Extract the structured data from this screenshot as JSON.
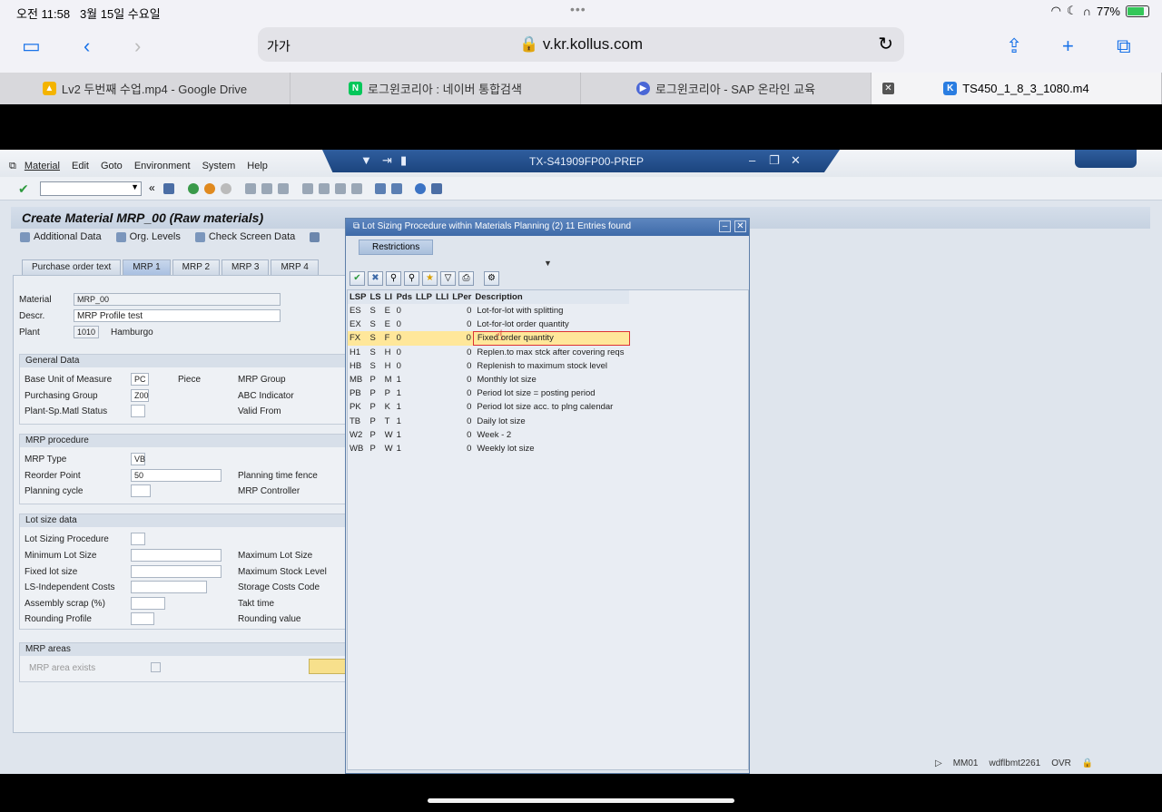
{
  "ipad": {
    "time": "오전 11:58",
    "date": "3월 15일 수요일",
    "battery": "77%",
    "battery_level": 0.77
  },
  "safari": {
    "text_size": "가가",
    "url": "v.kr.kollus.com"
  },
  "browser_tabs": [
    {
      "label": "Lv2 두번째 수업.mp4 - Google Drive",
      "icon": "google-drive-icon"
    },
    {
      "label": "로그윈코리아 : 네이버 통합검색",
      "icon": "naver-icon"
    },
    {
      "label": "로그윈코리아 - SAP 온라인 교육",
      "icon": "play-icon"
    },
    {
      "label": "TS450_1_8_3_1080.m4",
      "icon": "kollus-icon"
    }
  ],
  "sap": {
    "menu": [
      "Material",
      "Edit",
      "Goto",
      "Environment",
      "System",
      "Help"
    ],
    "system": "TX-S41909FP00-PREP",
    "screen_title": "Create Material MRP_00 (Raw materials)",
    "app_toolbar": [
      "Additional Data",
      "Org. Levels",
      "Check Screen Data"
    ],
    "tabs": [
      "Purchase order text",
      "MRP 1",
      "MRP 2",
      "MRP 3",
      "MRP 4"
    ],
    "header": {
      "material_label": "Material",
      "material": "MRP_00",
      "descr_label": "Descr.",
      "descr": "MRP Profile test",
      "plant_label": "Plant",
      "plant": "1010",
      "plant_name": "Hamburgo"
    },
    "general": {
      "title": "General Data",
      "buom_label": "Base Unit of Measure",
      "buom": "PC",
      "buom_text": "Piece",
      "mrp_group": "MRP Group",
      "pgrp_label": "Purchasing Group",
      "pgrp": "Z00",
      "abc": "ABC Indicator",
      "status_label": "Plant-Sp.Matl Status",
      "valid_from": "Valid From"
    },
    "mrp_proc": {
      "title": "MRP procedure",
      "type_label": "MRP Type",
      "type": "VB",
      "reorder_label": "Reorder Point",
      "reorder": "50",
      "fence": "Planning time fence",
      "cycle_label": "Planning cycle",
      "controller": "MRP Controller"
    },
    "lot": {
      "title": "Lot size data",
      "lsp": "Lot Sizing Procedure",
      "min": "Minimum Lot Size",
      "max": "Maximum Lot Size",
      "fixed": "Fixed lot size",
      "maxstock": "Maximum Stock Level",
      "lsind": "LS-Independent Costs",
      "storage": "Storage Costs Code",
      "scrap": "Assembly scrap (%)",
      "takt": "Takt time",
      "rprof": "Rounding Profile",
      "rval": "Rounding value"
    },
    "areas": {
      "title": "MRP areas",
      "exists": "MRP area exists"
    },
    "status": {
      "tcode": "MM01",
      "server": "wdflbmt2261",
      "mode": "OVR"
    }
  },
  "dialog": {
    "title": "Lot Sizing Procedure within Materials Planning (2)   11 Entries found",
    "restrictions": "Restrictions",
    "columns": [
      "LSP",
      "LS",
      "LI",
      "Pds",
      "LLP",
      "LLI",
      "LPer",
      "Description"
    ],
    "rows": [
      [
        "ES",
        "S",
        "E",
        "0",
        "",
        "",
        "0",
        "Lot-for-lot with splitting"
      ],
      [
        "EX",
        "S",
        "E",
        "0",
        "",
        "",
        "0",
        "Lot-for-lot order quantity"
      ],
      [
        "FX",
        "S",
        "F",
        "0",
        "",
        "",
        "0",
        "Fixed order quantity"
      ],
      [
        "H1",
        "S",
        "H",
        "0",
        "",
        "",
        "0",
        "Replen.to max stck after covering reqs"
      ],
      [
        "HB",
        "S",
        "H",
        "0",
        "",
        "",
        "0",
        "Replenish to maximum stock level"
      ],
      [
        "MB",
        "P",
        "M",
        "1",
        "",
        "",
        "0",
        "Monthly lot size"
      ],
      [
        "PB",
        "P",
        "P",
        "1",
        "",
        "",
        "0",
        "Period lot size = posting period"
      ],
      [
        "PK",
        "P",
        "K",
        "1",
        "",
        "",
        "0",
        "Period lot size acc. to plng calendar"
      ],
      [
        "TB",
        "P",
        "T",
        "1",
        "",
        "",
        "0",
        "Daily lot size"
      ],
      [
        "W2",
        "P",
        "W",
        "1",
        "",
        "",
        "0",
        "Week - 2"
      ],
      [
        "WB",
        "P",
        "W",
        "1",
        "",
        "",
        "0",
        "Weekly lot size"
      ]
    ]
  }
}
